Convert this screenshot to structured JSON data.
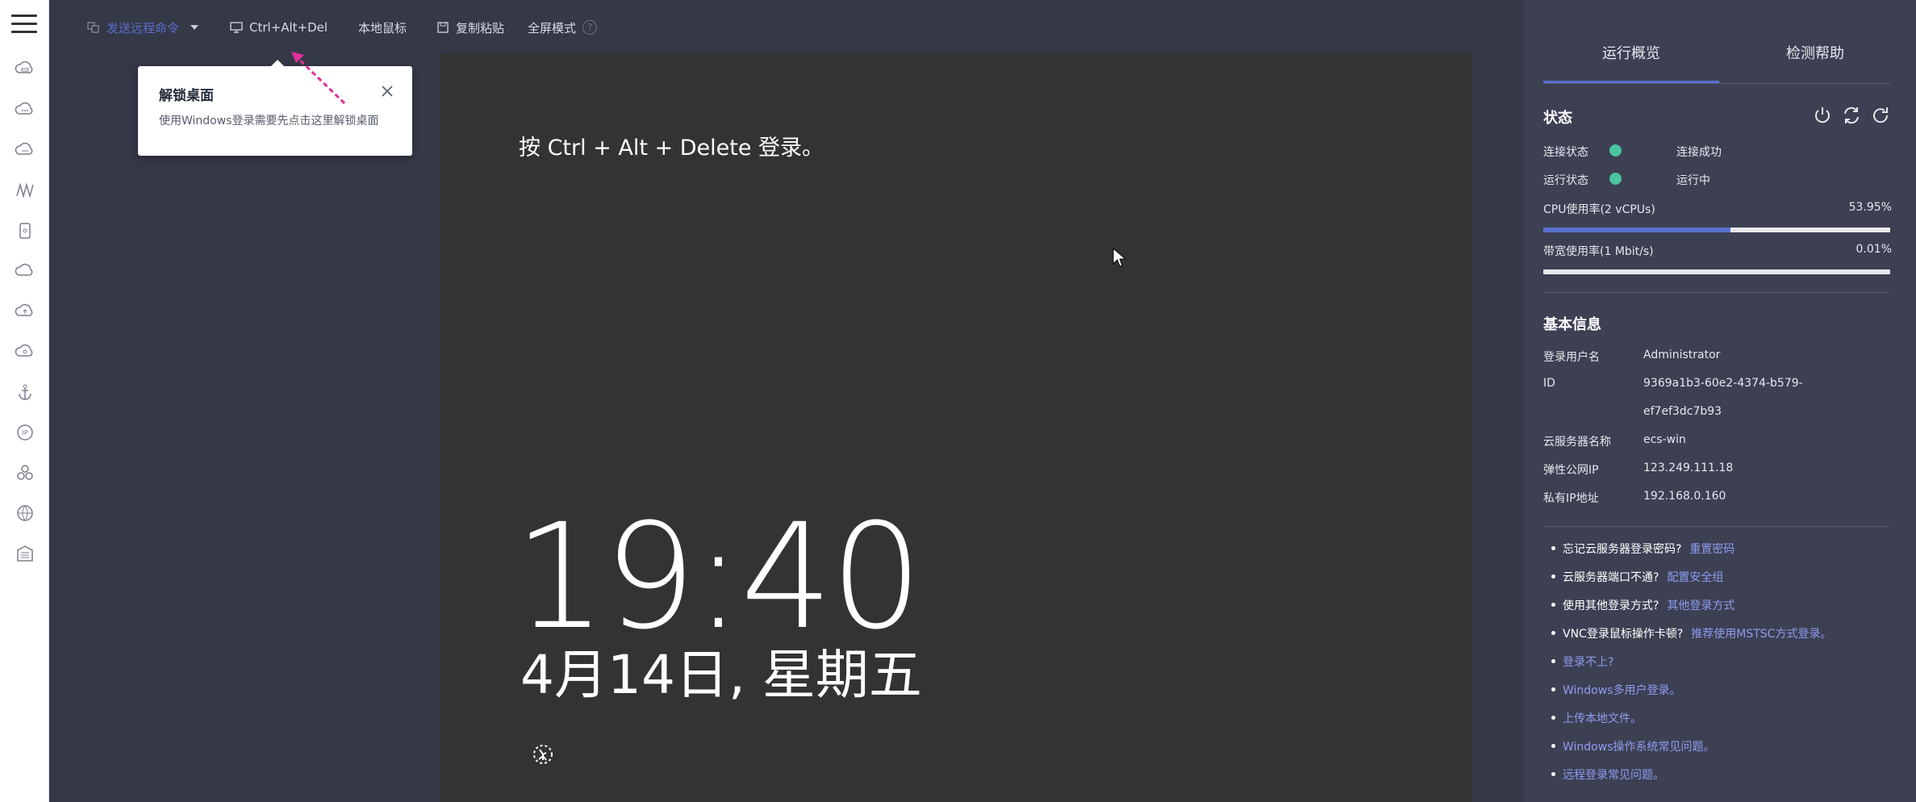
{
  "toolbar": {
    "send_command": "发送远程命令",
    "ctrl_alt_del": "Ctrl+Alt+Del",
    "local_mouse": "本地鼠标",
    "copy_paste": "复制粘贴",
    "fullscreen": "全屏模式",
    "help_mark": "?"
  },
  "popover": {
    "title": "解锁桌面",
    "description": "使用Windows登录需要先点击这里解锁桌面"
  },
  "screen": {
    "login_hint": "按 Ctrl + Alt + Delete 登录。",
    "time": "19:40",
    "date": "4月14日, 星期五"
  },
  "panel": {
    "tabs": [
      "运行概览",
      "检测帮助"
    ],
    "status": {
      "title": "状态",
      "connection_label": "连接状态",
      "connection_value": "连接成功",
      "run_label": "运行状态",
      "run_value": "运行中",
      "cpu_label": "CPU使用率(2 vCPUs)",
      "cpu_pct": "53.95%",
      "cpu_fraction": 0.5395,
      "bw_label": "带宽使用率(1 Mbit/s)",
      "bw_pct": "0.01%",
      "bw_fraction": 0.0001
    },
    "basic": {
      "title": "基本信息",
      "user_label": "登录用户名",
      "user_value": "Administrator",
      "id_label": "ID",
      "id_value_1": "9369a1b3-60e2-4374-b579-",
      "id_value_2": "ef7ef3dc7b93",
      "name_label": "云服务器名称",
      "name_value": "ecs-win",
      "eip_label": "弹性公网IP",
      "eip_value": "123.249.111.18",
      "pip_label": "私有IP地址",
      "pip_value": "192.168.0.160"
    },
    "help": [
      {
        "q": "忘记云服务器登录密码?",
        "link": "重置密码"
      },
      {
        "q": "云服务器端口不通?",
        "link": "配置安全组"
      },
      {
        "q": "使用其他登录方式?",
        "link": "其他登录方式"
      },
      {
        "q": "VNC登录鼠标操作卡顿?",
        "link": "推荐使用MSTSC方式登录。"
      },
      {
        "q": "",
        "link": "登录不上?"
      },
      {
        "q": "",
        "link": "Windows多用户登录。"
      },
      {
        "q": "",
        "link": "上传本地文件。"
      },
      {
        "q": "",
        "link": "Windows操作系统常见问题。"
      },
      {
        "q": "",
        "link": "远程登录常见问题。"
      }
    ]
  },
  "colors": {
    "accent": "#5b6fcf",
    "status_ok": "#4cc4a0",
    "link": "#8d9cf0",
    "annotation_arrow": "#e0309a"
  }
}
